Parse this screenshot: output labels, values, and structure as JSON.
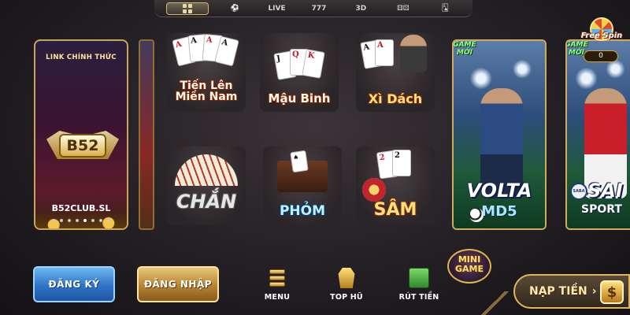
{
  "topbar": {
    "tabs": [
      {
        "icon": "grid-icon",
        "label": ""
      },
      {
        "icon": "soccer-ball-icon",
        "label": "⚽"
      },
      {
        "icon": "live-icon",
        "label": "LIVE"
      },
      {
        "icon": "slot-777-icon",
        "label": "777"
      },
      {
        "icon": "lottery-icon",
        "label": "3D"
      },
      {
        "icon": "dice-icon",
        "label": "⚅⚄"
      },
      {
        "icon": "cards-icon",
        "label": "🂡"
      }
    ]
  },
  "banner": {
    "link_label": "LINK CHÍNH THỨC",
    "logo_text": "B52",
    "site": "B52CLUB.SL",
    "dots": 8,
    "active_dot": 4
  },
  "games": [
    {
      "id": "tien-len",
      "title_line1": "Tiến Lên",
      "title_line2": "Miền Nam"
    },
    {
      "id": "mau-binh",
      "title_line1": "Mậu Binh",
      "title_line2": ""
    },
    {
      "id": "xi-dach",
      "title_line1": "Xì Dách",
      "title_line2": ""
    },
    {
      "id": "chan",
      "title_line1": "CHẮN",
      "title_line2": ""
    },
    {
      "id": "phom",
      "title_line1": "PHỎM",
      "title_line2": ""
    },
    {
      "id": "sam",
      "title_line1": "SÂM",
      "title_line2": ""
    }
  ],
  "features": [
    {
      "id": "volta",
      "new_label": "GAME MỚI",
      "title": "VOLTA",
      "sub": "MD5"
    },
    {
      "id": "saba",
      "new_label": "GAME MỚI",
      "title": "SAI",
      "sub": "SPORT",
      "badge": "SABA"
    }
  ],
  "free_spin": {
    "label": "Free Spin",
    "count": "0"
  },
  "bottom": {
    "register": "ĐĂNG KÝ",
    "login": "ĐĂNG NHẬP",
    "menu": "MENU",
    "top_hu": "TOP HŨ",
    "rut_tien": "RÚT TIỀN",
    "mini_game_line1": "MINI",
    "mini_game_line2": "GAME",
    "deposit": "NẠP TIỀN",
    "deposit_arrow": "›",
    "deposit_icon": "$"
  },
  "colors": {
    "accent_gold": "#d0ab5f",
    "register_blue": "#2f73c6",
    "login_gold": "#b68333",
    "background": "#231f24"
  }
}
